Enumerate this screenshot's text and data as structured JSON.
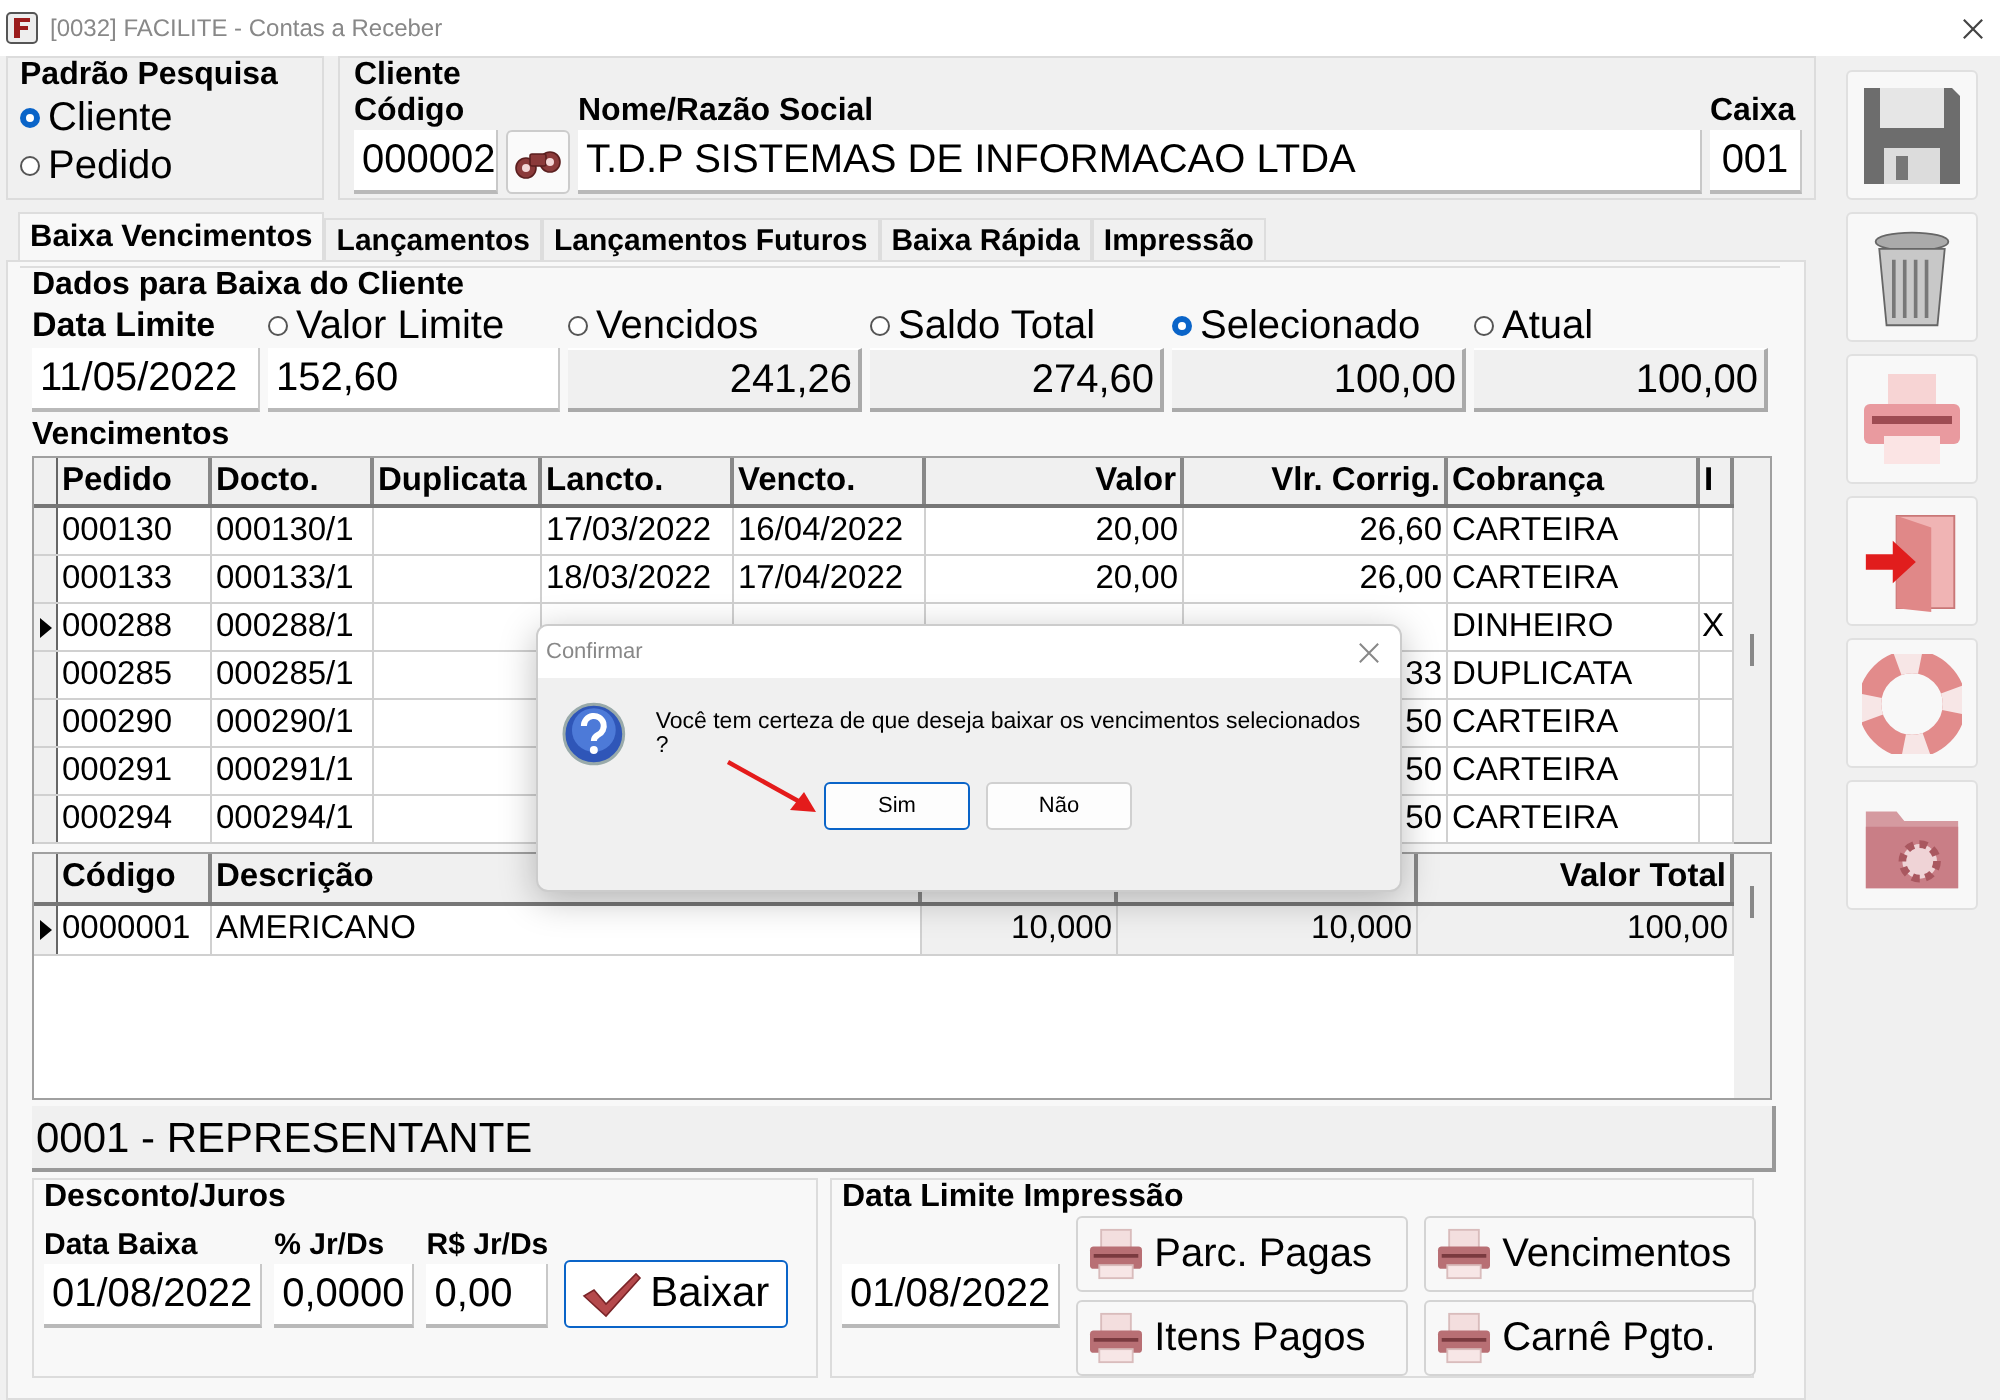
{
  "window": {
    "title": "[0032] FACILITE - Contas a Receber"
  },
  "search_mode": {
    "title": "Padrão Pesquisa",
    "options": [
      {
        "label": "Cliente",
        "selected": true
      },
      {
        "label": "Pedido",
        "selected": false
      }
    ]
  },
  "cliente": {
    "title": "Cliente",
    "codigo_label": "Código",
    "codigo": "000002",
    "nome_label": "Nome/Razão Social",
    "nome": "T.D.P SISTEMAS DE INFORMACAO LTDA",
    "caixa_label": "Caixa",
    "caixa": "001"
  },
  "tabs": [
    {
      "label": "Baixa Vencimentos",
      "selected": true
    },
    {
      "label": "Lançamentos",
      "selected": false
    },
    {
      "label": "Lançamentos Futuros",
      "selected": false
    },
    {
      "label": "Baixa Rápida",
      "selected": false
    },
    {
      "label": "Impressão",
      "selected": false
    }
  ],
  "dados": {
    "title": "Dados para Baixa do Cliente",
    "data_limite_label": "Data Limite",
    "data_limite": "11/05/2022",
    "options": [
      {
        "label": "Valor Limite",
        "selected": false,
        "value": "152,60",
        "kind": "input"
      },
      {
        "label": "Vencidos",
        "selected": false,
        "value": "241,26",
        "kind": "total"
      },
      {
        "label": "Saldo Total",
        "selected": false,
        "value": "274,60",
        "kind": "total"
      },
      {
        "label": "Selecionado",
        "selected": true,
        "value": "100,00",
        "kind": "total"
      },
      {
        "label": "Atual",
        "selected": false,
        "value": "100,00",
        "kind": "total"
      }
    ]
  },
  "vencimentos": {
    "title": "Vencimentos",
    "columns": [
      "Pedido",
      "Docto.",
      "Duplicata",
      "Lancto.",
      "Vencto.",
      "Valor",
      "Vlr. Corrig.",
      "Cobrança",
      "I"
    ],
    "rows": [
      {
        "current": false,
        "cells": [
          "000130",
          "000130/1",
          null,
          "17/03/2022",
          "16/04/2022",
          "20,00",
          "26,60",
          "CARTEIRA",
          null
        ]
      },
      {
        "current": false,
        "cells": [
          "000133",
          "000133/1",
          null,
          "18/03/2022",
          "17/04/2022",
          "20,00",
          "26,00",
          "CARTEIRA",
          null
        ]
      },
      {
        "current": true,
        "cells": [
          "000288",
          "000288/1",
          null,
          null,
          null,
          null,
          null,
          "DINHEIRO",
          "X"
        ]
      },
      {
        "current": false,
        "cells": [
          "000285",
          "000285/1",
          null,
          null,
          null,
          null,
          "33",
          "DUPLICATA",
          null
        ]
      },
      {
        "current": false,
        "cells": [
          "000290",
          "000290/1",
          null,
          null,
          null,
          null,
          "50",
          "CARTEIRA",
          null
        ]
      },
      {
        "current": false,
        "cells": [
          "000291",
          "000291/1",
          null,
          null,
          null,
          null,
          "50",
          "CARTEIRA",
          null
        ]
      },
      {
        "current": false,
        "cells": [
          "000294",
          "000294/1",
          null,
          null,
          null,
          null,
          "50",
          "CARTEIRA",
          null
        ]
      }
    ]
  },
  "itens": {
    "columns": [
      "Código",
      "Descrição",
      null,
      null,
      "Valor Total"
    ],
    "rows": [
      {
        "current": true,
        "cells": [
          "0000001",
          "AMERICANO",
          "10,000",
          "10,000",
          "100,00"
        ]
      }
    ]
  },
  "representante": "0001 - REPRESENTANTE",
  "desconto": {
    "title": "Desconto/Juros",
    "fields": [
      {
        "label": "Data Baixa",
        "value": "01/08/2022"
      },
      {
        "label": "% Jr/Ds",
        "value": "0,0000"
      },
      {
        "label": "R$ Jr/Ds",
        "value": "0,00"
      }
    ],
    "button": "Baixar"
  },
  "impressao": {
    "title": "Data Limite Impressão",
    "date": "01/08/2022",
    "buttons": [
      "Parc. Pagas",
      "Vencimentos",
      "Itens Pagos",
      "Carnê Pgto."
    ]
  },
  "dialog": {
    "title": "Confirmar",
    "message": "Você tem certeza de que deseja baixar os vencimentos selecionados ?",
    "buttons": [
      {
        "label": "Sim",
        "selected": true
      },
      {
        "label": "Não",
        "selected": false
      }
    ]
  }
}
